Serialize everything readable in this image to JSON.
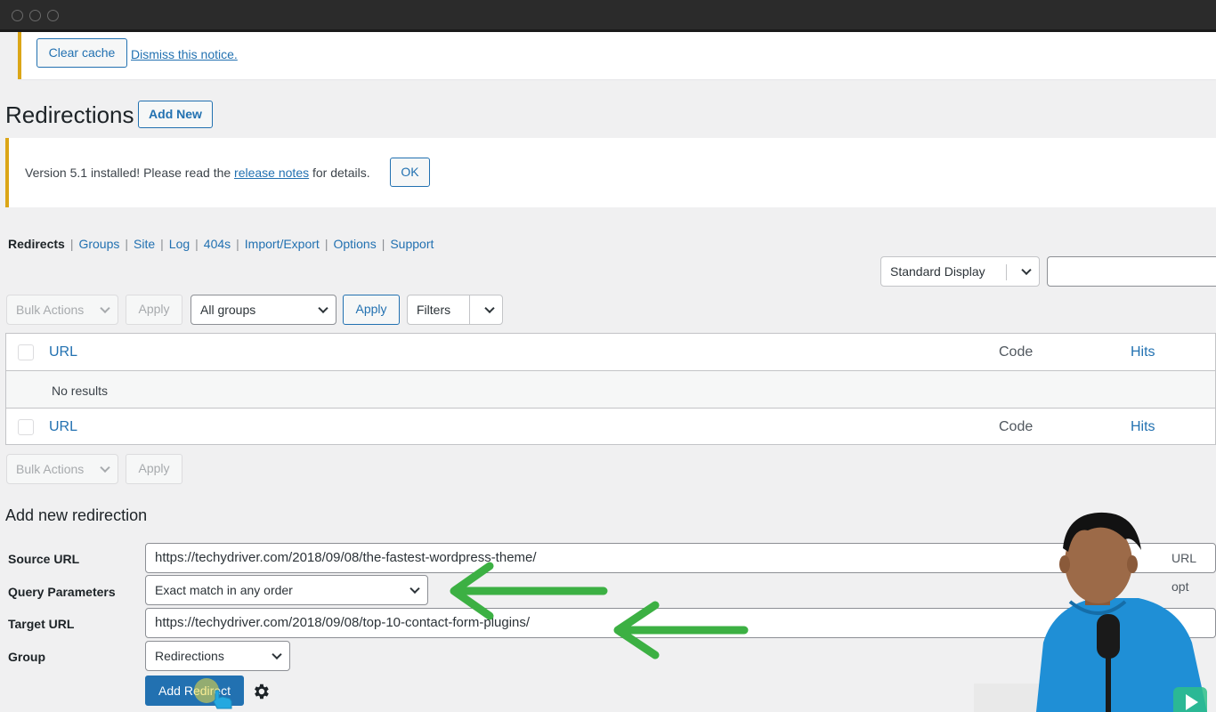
{
  "notice_cache": {
    "clear_cache": "Clear cache",
    "dismiss": "Dismiss this notice."
  },
  "page_title": "Redirections",
  "add_new": "Add New",
  "version_notice": {
    "prefix": "Version 5.1 installed! Please read the ",
    "link": "release notes",
    "suffix": " for details.",
    "ok": "OK"
  },
  "subnav": {
    "items": [
      "Redirects",
      "Groups",
      "Site",
      "Log",
      "404s",
      "Import/Export",
      "Options",
      "Support"
    ]
  },
  "display_select": "Standard Display",
  "search_value": "",
  "toolbar_top": {
    "bulk_actions": "Bulk Actions",
    "apply": "Apply",
    "groups_select": "All groups",
    "apply2": "Apply",
    "filters": "Filters"
  },
  "table": {
    "col_url": "URL",
    "col_code": "Code",
    "col_hits": "Hits",
    "empty": "No results"
  },
  "toolbar_bottom": {
    "bulk_actions": "Bulk Actions",
    "apply": "Apply"
  },
  "form": {
    "heading": "Add new redirection",
    "source_label": "Source URL",
    "source_value": "https://techydriver.com/2018/09/08/the-fastest-wordpress-theme/",
    "source_options_peek": "URL opt",
    "query_label": "Query Parameters",
    "query_value": "Exact match in any order",
    "target_label": "Target URL",
    "target_value": "https://techydriver.com/2018/09/08/top-10-contact-form-plugins/",
    "group_label": "Group",
    "group_value": "Redirections",
    "submit": "Add Redirect"
  },
  "colors": {
    "accent": "#2271b1",
    "notice_border": "#dba617",
    "arrow": "#3cb043"
  },
  "icons": [
    "gear-icon",
    "chevron-down-icon",
    "arrow-left-icon"
  ]
}
